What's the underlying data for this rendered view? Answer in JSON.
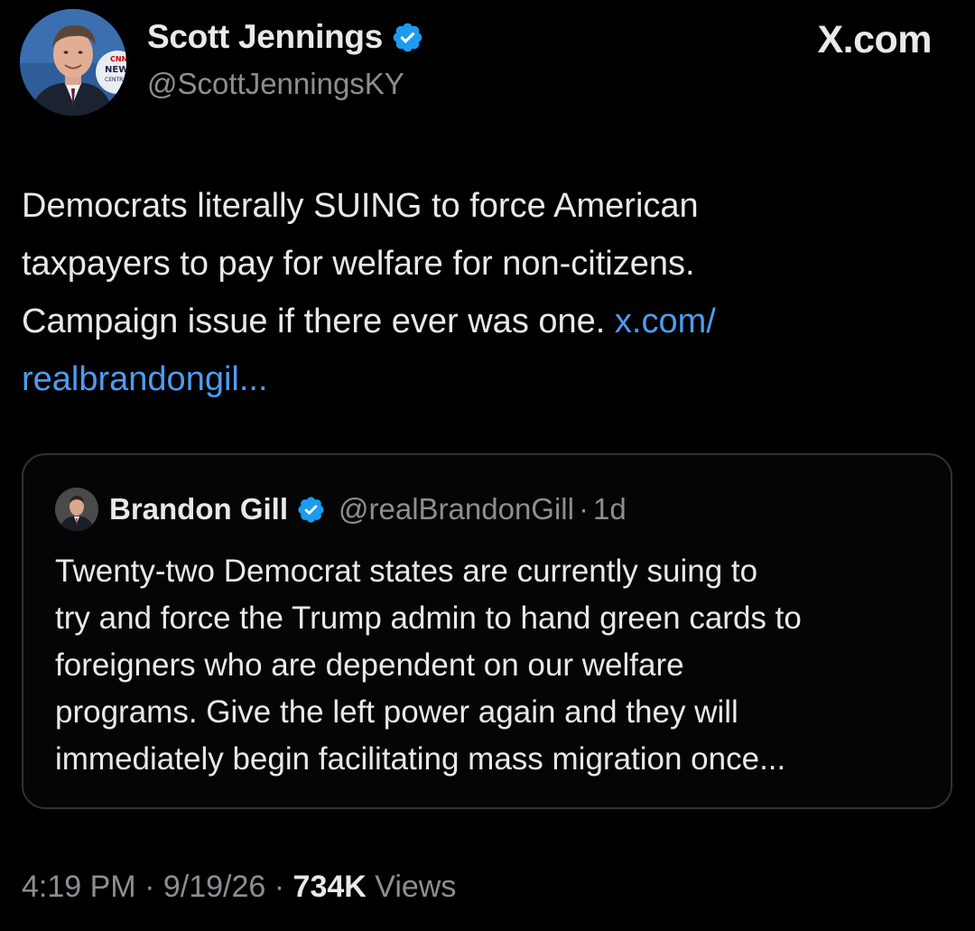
{
  "author": {
    "name": "Scott Jennings",
    "handle": "@ScottJenningsKY",
    "verified": true,
    "avatar_badge_text": "CNN NEWS CENTRAL"
  },
  "site_label": "X.com",
  "tweet": {
    "lines": [
      "Democrats literally SUING to force American",
      "taxpayers to pay for welfare for non-citizens.",
      "Campaign issue if there ever was one."
    ],
    "link_part1": "x.com/",
    "link_part2": "realbrandongil..."
  },
  "quoted_tweet": {
    "name": "Brandon Gill",
    "handle": "@realBrandonGill",
    "separator": "·",
    "age": "1d",
    "verified": true,
    "lines": [
      "Twenty-two Democrat states are currently suing to",
      "try and force the Trump admin to hand green cards to",
      "foreigners who are dependent on our welfare",
      "programs. Give the left power again and they will",
      "immediately begin facilitating mass migration once..."
    ]
  },
  "meta": {
    "time": "4:19 PM",
    "separator": "·",
    "date": "9/19/26",
    "views_count": "734K",
    "views_label": "Views"
  },
  "colors": {
    "background": "#000000",
    "text": "#e7e9ea",
    "muted": "#8b8f93",
    "link": "#4e9cf0",
    "verified": "#1d9bf0",
    "card_border": "#2f3336"
  },
  "icons": {
    "verified": "verified-badge-icon"
  }
}
